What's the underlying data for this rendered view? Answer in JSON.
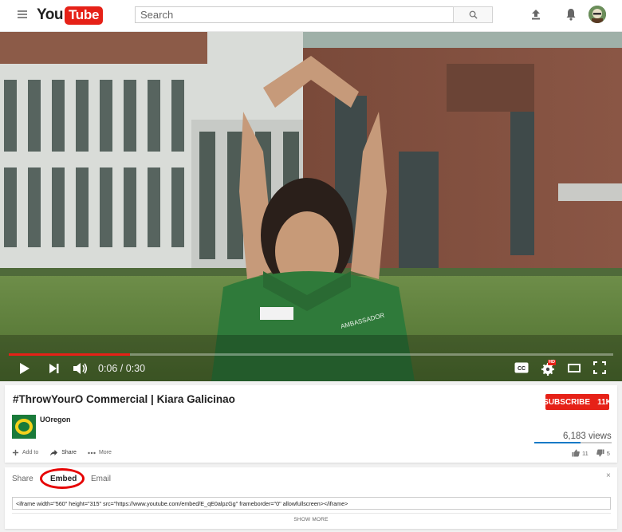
{
  "masthead": {
    "logo_you": "You",
    "logo_tube": "Tube",
    "search_placeholder": "Search"
  },
  "player": {
    "time_current": "0:06",
    "time_total": "0:30",
    "time_display": "0:06 / 0:30",
    "progress_fraction": 0.2,
    "hd_badge": "HD",
    "shirt_text": "AMBASSADOR"
  },
  "video": {
    "title": "#ThrowYourO Commercial | Kiara Galicinao",
    "subscribe_label": "SUBSCRIBE",
    "subscriber_count": "11K",
    "channel_name": "UOregon",
    "channel_logo_letter": "O",
    "views": "6,183 views",
    "actions": {
      "add_to": "Add to",
      "share": "Share",
      "more": "More"
    },
    "likes": "11",
    "dislikes": "5"
  },
  "share_panel": {
    "tabs": [
      {
        "label": "Share"
      },
      {
        "label": "Embed"
      },
      {
        "label": "Email"
      }
    ],
    "active_tab": "Embed",
    "close_icon": "×",
    "embed_code": "<iframe width=\"560\" height=\"315\" src=\"https://www.youtube.com/embed/E_qE0alpzGg\" frameborder=\"0\" allowfullscreen></iframe>",
    "show_more": "SHOW MORE"
  },
  "colors": {
    "brand_red": "#e62117",
    "accent_blue": "#167ac6",
    "oregon_green": "#1a7a3a"
  }
}
